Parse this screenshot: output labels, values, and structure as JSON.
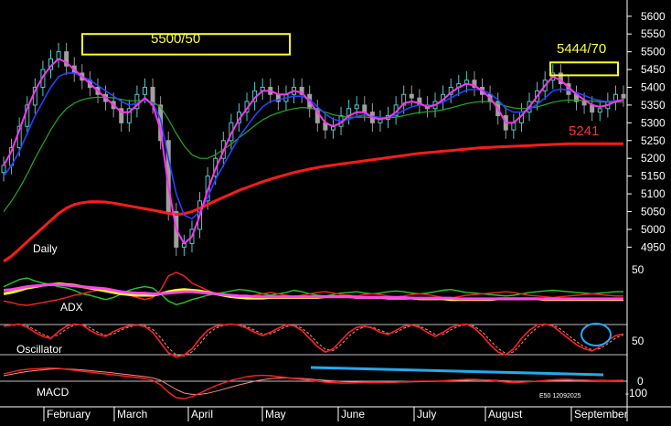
{
  "chart_data": {
    "type": "line",
    "instrument": "E50 12092025",
    "months": [
      "February",
      "March",
      "April",
      "May",
      "June",
      "July",
      "August",
      "September"
    ],
    "price_axis": {
      "ticks": [
        5600,
        5550,
        5500,
        5450,
        5400,
        5350,
        5300,
        5250,
        5200,
        5150,
        5100,
        5050,
        5000,
        4950
      ],
      "ylim": [
        4920,
        5620
      ]
    },
    "price_series": {
      "close": [
        5180,
        5230,
        5290,
        5350,
        5400,
        5450,
        5480,
        5500,
        5460,
        5440,
        5420,
        5400,
        5380,
        5360,
        5340,
        5300,
        5340,
        5380,
        5400,
        5350,
        5250,
        5050,
        4950,
        4960,
        5000,
        5080,
        5150,
        5200,
        5250,
        5300,
        5330,
        5360,
        5390,
        5400,
        5380,
        5360,
        5380,
        5400,
        5380,
        5340,
        5300,
        5280,
        5290,
        5320,
        5340,
        5350,
        5330,
        5300,
        5310,
        5320,
        5350,
        5380,
        5370,
        5350,
        5340,
        5360,
        5380,
        5400,
        5410,
        5420,
        5400,
        5380,
        5360,
        5320,
        5280,
        5300,
        5330,
        5360,
        5390,
        5420,
        5440,
        5410,
        5380,
        5360,
        5350,
        5330,
        5340,
        5360,
        5380,
        5370
      ],
      "ema_pink": [
        5180,
        5220,
        5280,
        5340,
        5390,
        5430,
        5460,
        5480,
        5470,
        5450,
        5430,
        5410,
        5390,
        5370,
        5350,
        5330,
        5330,
        5350,
        5370,
        5350,
        5280,
        5120,
        5000,
        4960,
        4980,
        5040,
        5110,
        5170,
        5220,
        5270,
        5310,
        5340,
        5370,
        5390,
        5390,
        5380,
        5380,
        5390,
        5385,
        5360,
        5330,
        5300,
        5290,
        5300,
        5320,
        5330,
        5330,
        5315,
        5310,
        5315,
        5330,
        5355,
        5360,
        5355,
        5345,
        5350,
        5365,
        5385,
        5400,
        5410,
        5405,
        5390,
        5370,
        5340,
        5300,
        5300,
        5320,
        5345,
        5375,
        5405,
        5430,
        5420,
        5400,
        5380,
        5365,
        5350,
        5345,
        5350,
        5360,
        5365
      ],
      "ema_blue": [
        5150,
        5180,
        5220,
        5270,
        5320,
        5360,
        5400,
        5430,
        5440,
        5440,
        5430,
        5420,
        5405,
        5390,
        5375,
        5360,
        5350,
        5355,
        5365,
        5355,
        5310,
        5200,
        5100,
        5040,
        5030,
        5050,
        5090,
        5140,
        5180,
        5220,
        5260,
        5290,
        5320,
        5345,
        5360,
        5365,
        5370,
        5375,
        5375,
        5365,
        5345,
        5325,
        5310,
        5305,
        5310,
        5318,
        5322,
        5318,
        5315,
        5315,
        5322,
        5335,
        5345,
        5350,
        5348,
        5350,
        5358,
        5370,
        5382,
        5392,
        5395,
        5392,
        5382,
        5365,
        5340,
        5330,
        5330,
        5338,
        5352,
        5370,
        5390,
        5395,
        5392,
        5385,
        5377,
        5368,
        5362,
        5360,
        5362,
        5364
      ],
      "ma_green": [
        5050,
        5080,
        5115,
        5155,
        5200,
        5240,
        5280,
        5315,
        5340,
        5355,
        5365,
        5370,
        5372,
        5372,
        5370,
        5366,
        5362,
        5362,
        5363,
        5358,
        5345,
        5310,
        5270,
        5235,
        5210,
        5200,
        5200,
        5210,
        5225,
        5240,
        5258,
        5275,
        5292,
        5308,
        5320,
        5328,
        5335,
        5340,
        5343,
        5342,
        5337,
        5330,
        5323,
        5318,
        5316,
        5316,
        5316,
        5315,
        5314,
        5314,
        5316,
        5320,
        5325,
        5329,
        5331,
        5333,
        5337,
        5342,
        5348,
        5354,
        5358,
        5360,
        5359,
        5355,
        5347,
        5342,
        5340,
        5341,
        5345,
        5351,
        5358,
        5362,
        5364,
        5364,
        5363,
        5361,
        5359,
        5358,
        5358,
        5358
      ],
      "ma_red": [
        4910,
        4925,
        4945,
        4965,
        4985,
        5005,
        5025,
        5045,
        5060,
        5070,
        5075,
        5078,
        5078,
        5077,
        5074,
        5070,
        5066,
        5062,
        5058,
        5054,
        5050,
        5045,
        5042,
        5044,
        5050,
        5060,
        5070,
        5080,
        5090,
        5100,
        5110,
        5118,
        5126,
        5134,
        5141,
        5148,
        5154,
        5160,
        5165,
        5170,
        5174,
        5178,
        5181,
        5184,
        5187,
        5190,
        5193,
        5196,
        5199,
        5202,
        5205,
        5208,
        5211,
        5214,
        5216,
        5218,
        5220,
        5222,
        5224,
        5226,
        5228,
        5230,
        5231,
        5232,
        5233,
        5234,
        5235,
        5236,
        5237,
        5238,
        5239,
        5240,
        5241,
        5241,
        5241,
        5241,
        5241,
        5241,
        5241,
        5241
      ]
    },
    "annotations": {
      "box1_label": "5500/50",
      "box2_label": "5444/70",
      "red_level_label": "5241",
      "pane_daily": "Daily",
      "pane_adx": "ADX",
      "pane_oscillator": "Oscillator",
      "pane_macd": "MACD",
      "adx_tick": "50",
      "osc_tick": "50",
      "macd_ticks": [
        "0",
        "-100"
      ],
      "footer": "E50 12092025"
    },
    "adx_series": {
      "green": [
        40,
        45,
        50,
        52,
        48,
        45,
        43,
        40,
        38,
        35,
        30,
        28,
        25,
        22,
        25,
        30,
        35,
        38,
        40,
        38,
        30,
        20,
        15,
        18,
        22,
        25,
        28,
        30,
        32,
        34,
        36,
        35,
        33,
        30,
        28,
        30,
        32,
        35,
        33,
        30,
        28,
        27,
        29,
        31,
        32,
        33,
        31,
        30,
        31,
        33,
        34,
        33,
        31,
        30,
        31,
        33,
        35,
        36,
        34,
        32,
        31,
        30,
        29,
        28,
        27,
        28,
        30,
        32,
        33,
        34,
        35,
        34,
        33,
        32,
        31,
        30,
        31,
        32,
        33,
        33
      ],
      "red": [
        20,
        18,
        15,
        14,
        16,
        18,
        20,
        22,
        25,
        28,
        30,
        33,
        35,
        38,
        35,
        30,
        28,
        25,
        22,
        25,
        35,
        55,
        60,
        55,
        45,
        40,
        35,
        30,
        28,
        26,
        25,
        26,
        28,
        30,
        32,
        30,
        28,
        26,
        28,
        30,
        32,
        33,
        31,
        29,
        28,
        27,
        29,
        30,
        29,
        27,
        26,
        27,
        29,
        30,
        29,
        27,
        25,
        24,
        26,
        28,
        29,
        30,
        31,
        32,
        33,
        32,
        30,
        28,
        27,
        26,
        25,
        26,
        27,
        28,
        29,
        30,
        29,
        28,
        27,
        27
      ],
      "yellow": [
        30,
        32,
        35,
        38,
        40,
        42,
        43,
        44,
        43,
        42,
        40,
        38,
        36,
        34,
        32,
        30,
        29,
        28,
        28,
        28,
        30,
        33,
        35,
        36,
        35,
        34,
        32,
        30,
        28,
        26,
        25,
        24,
        24,
        24,
        25,
        25,
        25,
        25,
        25,
        25,
        25,
        26,
        26,
        26,
        26,
        25,
        25,
        25,
        25,
        24,
        24,
        24,
        24,
        23,
        23,
        23,
        23,
        22,
        22,
        22,
        22,
        22,
        22,
        23,
        23,
        23,
        23,
        23,
        23,
        22,
        22,
        22,
        22,
        22,
        22,
        22,
        22,
        22,
        22,
        22
      ],
      "magenta": [
        35,
        36,
        38,
        40,
        41,
        42,
        43,
        43,
        42,
        41,
        40,
        39,
        38,
        37,
        35,
        33,
        32,
        31,
        31,
        30,
        30,
        31,
        32,
        33,
        33,
        32,
        31,
        30,
        29,
        28,
        27,
        27,
        26,
        26,
        26,
        26,
        26,
        26,
        26,
        26,
        26,
        26,
        26,
        26,
        26,
        25,
        25,
        25,
        25,
        25,
        25,
        25,
        24,
        24,
        24,
        24,
        24,
        24,
        23,
        23,
        23,
        23,
        23,
        23,
        23,
        23,
        23,
        23,
        23,
        23,
        23,
        23,
        23,
        23,
        23,
        23,
        23,
        23,
        23,
        23
      ]
    },
    "osc_series": [
      85,
      88,
      90,
      82,
      70,
      60,
      55,
      72,
      85,
      90,
      88,
      75,
      65,
      60,
      72,
      80,
      86,
      88,
      84,
      70,
      45,
      20,
      10,
      15,
      30,
      55,
      75,
      85,
      88,
      90,
      87,
      80,
      70,
      62,
      70,
      80,
      88,
      86,
      75,
      55,
      35,
      22,
      30,
      50,
      70,
      82,
      85,
      80,
      70,
      65,
      75,
      85,
      88,
      82,
      70,
      60,
      70,
      82,
      88,
      90,
      80,
      62,
      40,
      22,
      15,
      30,
      55,
      75,
      88,
      90,
      85,
      70,
      55,
      40,
      30,
      25,
      35,
      50,
      62,
      66
    ],
    "macd_series": {
      "line": [
        40,
        50,
        60,
        65,
        68,
        70,
        72,
        70,
        65,
        60,
        55,
        50,
        45,
        40,
        35,
        30,
        25,
        20,
        15,
        5,
        -20,
        -60,
        -90,
        -95,
        -85,
        -65,
        -45,
        -25,
        -10,
        5,
        15,
        25,
        30,
        32,
        30,
        25,
        20,
        15,
        10,
        5,
        0,
        -5,
        -8,
        -10,
        -10,
        -9,
        -8,
        -8,
        -7,
        -6,
        -5,
        -3,
        -1,
        0,
        0,
        0,
        2,
        5,
        8,
        10,
        10,
        8,
        5,
        0,
        -5,
        -8,
        -6,
        -3,
        0,
        4,
        8,
        10,
        10,
        8,
        6,
        4,
        3,
        3,
        4,
        5
      ],
      "signal": [
        30,
        38,
        46,
        53,
        58,
        62,
        66,
        68,
        67,
        65,
        62,
        58,
        54,
        50,
        45,
        40,
        35,
        30,
        25,
        18,
        5,
        -20,
        -45,
        -65,
        -72,
        -72,
        -66,
        -56,
        -44,
        -32,
        -20,
        -10,
        0,
        8,
        14,
        17,
        18,
        17,
        15,
        12,
        8,
        5,
        2,
        -1,
        -3,
        -5,
        -6,
        -7,
        -7,
        -7,
        -6,
        -5,
        -4,
        -3,
        -2,
        -1,
        0,
        1,
        3,
        5,
        7,
        7,
        6,
        4,
        2,
        0,
        -1,
        -1,
        -1,
        0,
        2,
        4,
        5,
        6,
        6,
        5,
        5,
        4,
        4,
        4
      ]
    }
  }
}
